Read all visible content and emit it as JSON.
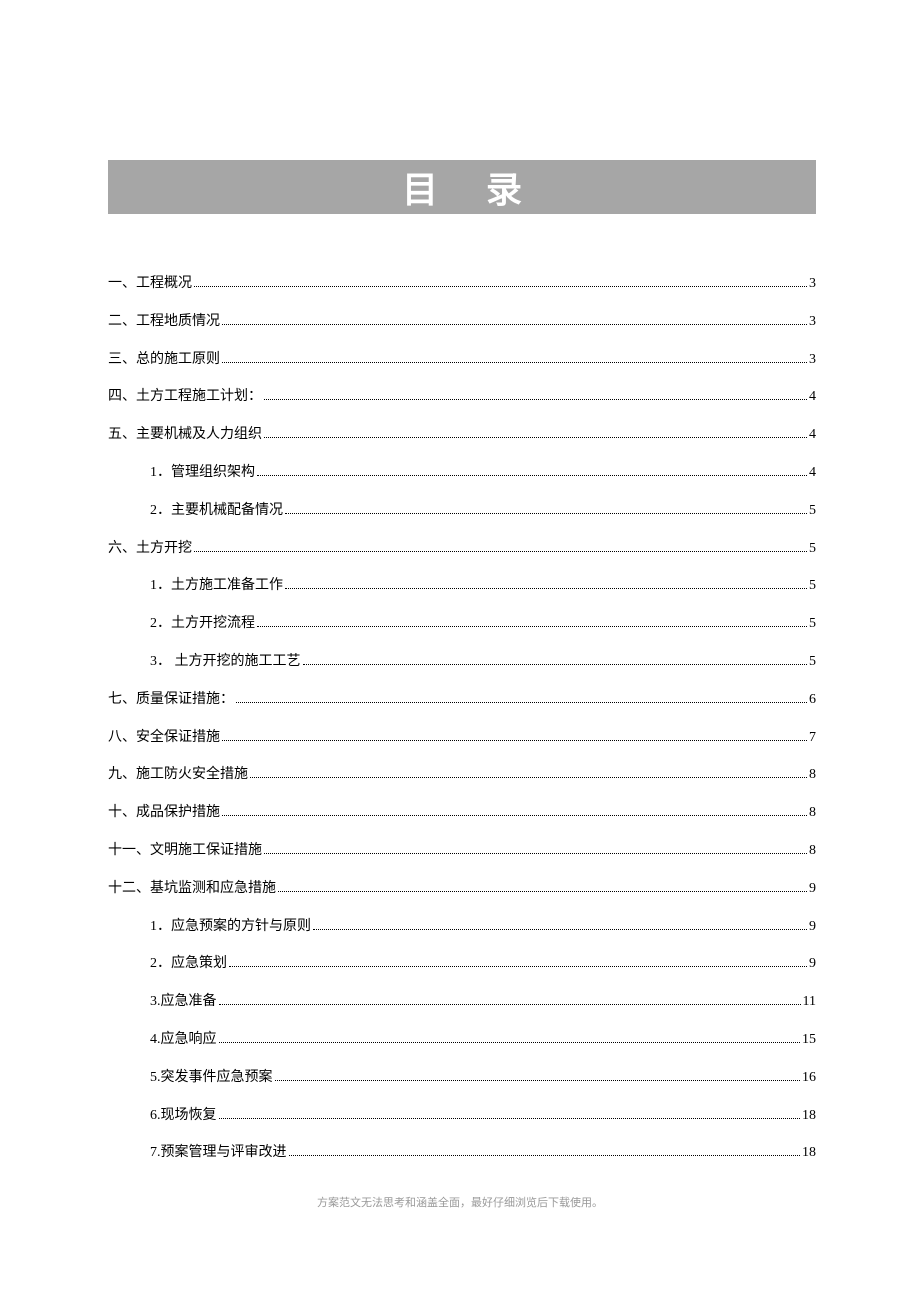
{
  "title": "目录",
  "footer": "方案范文无法思考和涵盖全面，最好仔细浏览后下载使用。",
  "toc": [
    {
      "level": 1,
      "label": "一、工程概况",
      "page": "3"
    },
    {
      "level": 1,
      "label": "二、工程地质情况",
      "page": "3"
    },
    {
      "level": 1,
      "label": "三、总的施工原则",
      "page": "3"
    },
    {
      "level": 1,
      "label": "四、土方工程施工计划：",
      "page": "4"
    },
    {
      "level": 1,
      "label": "五、主要机械及人力组织",
      "page": "4"
    },
    {
      "level": 2,
      "label": "1．管理组织架构",
      "page": "4"
    },
    {
      "level": 2,
      "label": "2．主要机械配备情况",
      "page": "5"
    },
    {
      "level": 1,
      "label": "六、土方开挖",
      "page": "5"
    },
    {
      "level": 2,
      "label": "1．土方施工准备工作",
      "page": "5"
    },
    {
      "level": 2,
      "label": "2．土方开挖流程",
      "page": "5"
    },
    {
      "level": 2,
      "label": "3．  土方开挖的施工工艺",
      "page": "5"
    },
    {
      "level": 1,
      "label": "七、质量保证措施：",
      "page": "6"
    },
    {
      "level": 1,
      "label": "八、安全保证措施",
      "page": "7"
    },
    {
      "level": 1,
      "label": "九、施工防火安全措施",
      "page": "8"
    },
    {
      "level": 1,
      "label": "十、成品保护措施",
      "page": "8"
    },
    {
      "level": 1,
      "label": "十一、文明施工保证措施",
      "page": "8"
    },
    {
      "level": 1,
      "label": "十二、基坑监测和应急措施",
      "page": "9"
    },
    {
      "level": 2,
      "label": "1．应急预案的方针与原则",
      "page": "9"
    },
    {
      "level": 2,
      "label": "2．应急策划",
      "page": "9"
    },
    {
      "level": 2,
      "label": "3.应急准备",
      "page": "11"
    },
    {
      "level": 2,
      "label": "4.应急响应",
      "page": "15"
    },
    {
      "level": 2,
      "label": "5.突发事件应急预案",
      "page": "16"
    },
    {
      "level": 2,
      "label": "6.现场恢复",
      "page": "18"
    },
    {
      "level": 2,
      "label": "7.预案管理与评审改进",
      "page": "18"
    }
  ]
}
